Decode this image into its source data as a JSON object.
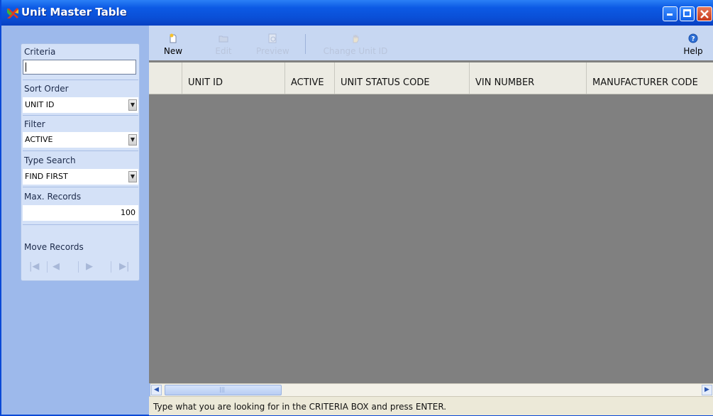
{
  "window": {
    "title": "Unit Master Table"
  },
  "toolbar": {
    "buttons": [
      {
        "label": "New",
        "icon": "new-document-icon",
        "enabled": true
      },
      {
        "label": "Edit",
        "icon": "folder-icon",
        "enabled": false
      },
      {
        "label": "Preview",
        "icon": "preview-icon",
        "enabled": false
      },
      {
        "label": "Change Unit ID",
        "icon": "hand-icon",
        "enabled": false
      },
      {
        "label": "Help",
        "icon": "help-icon",
        "enabled": true
      }
    ]
  },
  "sidebar": {
    "criteria_label": "Criteria",
    "criteria_value": "",
    "sort_order_label": "Sort Order",
    "sort_order_value": "UNIT ID",
    "filter_label": "Filter",
    "filter_value": "ACTIVE",
    "type_search_label": "Type Search",
    "type_search_value": "FIND FIRST",
    "max_records_label": "Max. Records",
    "max_records_value": "100",
    "move_records_label": "Move Records",
    "nav": [
      "first-record-icon",
      "previous-record-icon",
      "next-record-icon",
      "last-record-icon"
    ]
  },
  "grid": {
    "columns": [
      "",
      "UNIT ID",
      "ACTIVE",
      "UNIT STATUS CODE",
      "VIN NUMBER",
      "MANUFACTURER CODE"
    ],
    "rows": []
  },
  "status": {
    "message": "Type what you are looking for in the CRITERIA BOX and press ENTER."
  },
  "colors": {
    "titlebar": "#0a4fd6",
    "sidebar": "#9db9eb",
    "grid_empty": "#808080"
  }
}
